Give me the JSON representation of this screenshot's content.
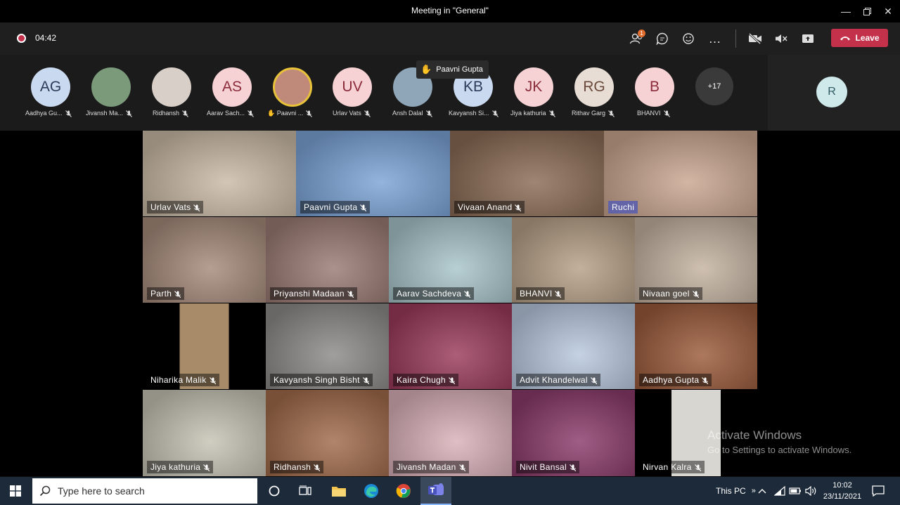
{
  "window": {
    "title": "Meeting in \"General\""
  },
  "toolbar": {
    "timer": "04:42",
    "participants_badge": "1",
    "leave_label": "Leave"
  },
  "strip": {
    "participants": [
      {
        "initials": "AG",
        "name": "Aadhya Gu...",
        "bg": "#c9d9ef",
        "fg": "#2d3a5a"
      },
      {
        "initials": "",
        "name": "Jivansh Ma...",
        "bg": "#7a9a7a",
        "fg": "#fff"
      },
      {
        "initials": "",
        "name": "Ridhansh",
        "bg": "#d8d0c8",
        "fg": "#fff"
      },
      {
        "initials": "AS",
        "name": "Aarav Sach...",
        "bg": "#f6d2d5",
        "fg": "#8a2b3a"
      },
      {
        "initials": "",
        "name": "Paavni ...",
        "bg": "#c08a7a",
        "fg": "#fff"
      },
      {
        "initials": "UV",
        "name": "Urlav Vats",
        "bg": "#f6d2d5",
        "fg": "#8a2b3a"
      },
      {
        "initials": "",
        "name": "Ansh Dalal",
        "bg": "#8fa6b8",
        "fg": "#fff"
      },
      {
        "initials": "KB",
        "name": "Kavyansh Si...",
        "bg": "#c9d9ef",
        "fg": "#2d3a5a"
      },
      {
        "initials": "JK",
        "name": "Jiya kathuria",
        "bg": "#f6d2d5",
        "fg": "#8a2b3a"
      },
      {
        "initials": "RG",
        "name": "Rithav Garg",
        "bg": "#e8ddd5",
        "fg": "#6a4a3a"
      },
      {
        "initials": "B",
        "name": "BHANVI",
        "bg": "#f6d2d5",
        "fg": "#8a2b3a"
      },
      {
        "initials": "+17",
        "name": "",
        "bg": "#3a3a3a",
        "fg": "#fff"
      }
    ],
    "pinned": {
      "initials": "R",
      "bg": "#cfe8ea",
      "fg": "#2e5a62"
    },
    "raised_hand_tooltip": "Paavni Gupta"
  },
  "tiles": [
    {
      "name": "Urlav Vats",
      "bg": "#c9b9a5"
    },
    {
      "name": "Paavni Gupta",
      "bg": "#7ba3d6"
    },
    {
      "name": "Vivaan  Anand",
      "bg": "#8a6b55"
    },
    {
      "name": "Ruchi",
      "bg": "#c9a58f",
      "highlight": true
    },
    {
      "name": "Parth",
      "bg": "#a5897a"
    },
    {
      "name": "Priyanshi Madaan",
      "bg": "#9a7a74"
    },
    {
      "name": "Aarav Sachdeva",
      "bg": "#a8c4c9"
    },
    {
      "name": "BHANVI",
      "bg": "#b59f86"
    },
    {
      "name": "Nivaan goel",
      "bg": "#c4b2a0"
    },
    {
      "name": "Niharika Malik",
      "bg": "#a88c6a"
    },
    {
      "name": "Kavyansh Singh Bisht",
      "bg": "#8c8a88"
    },
    {
      "name": "Kaira Chugh",
      "bg": "#9a3a5a"
    },
    {
      "name": "Advit Khandelwal",
      "bg": "#b8c8de"
    },
    {
      "name": "Aadhya Gupta",
      "bg": "#9a5a3a"
    },
    {
      "name": "Jiya kathuria",
      "bg": "#c6c2b4"
    },
    {
      "name": "Ridhansh",
      "bg": "#a06a4a"
    },
    {
      "name": "Jivansh Madan",
      "bg": "#d9b0b8"
    },
    {
      "name": "Nivit Bansal",
      "bg": "#8a3a6a"
    },
    {
      "name": "Nirvan Kalra",
      "bg": "#d8d6d0"
    }
  ],
  "watermark": {
    "line1": "Activate Windows",
    "line2": "Go to Settings to activate Windows."
  },
  "taskbar": {
    "search_placeholder": "Type here to search",
    "tray_label": "This PC",
    "time": "10:02",
    "date": "23/11/2021"
  }
}
